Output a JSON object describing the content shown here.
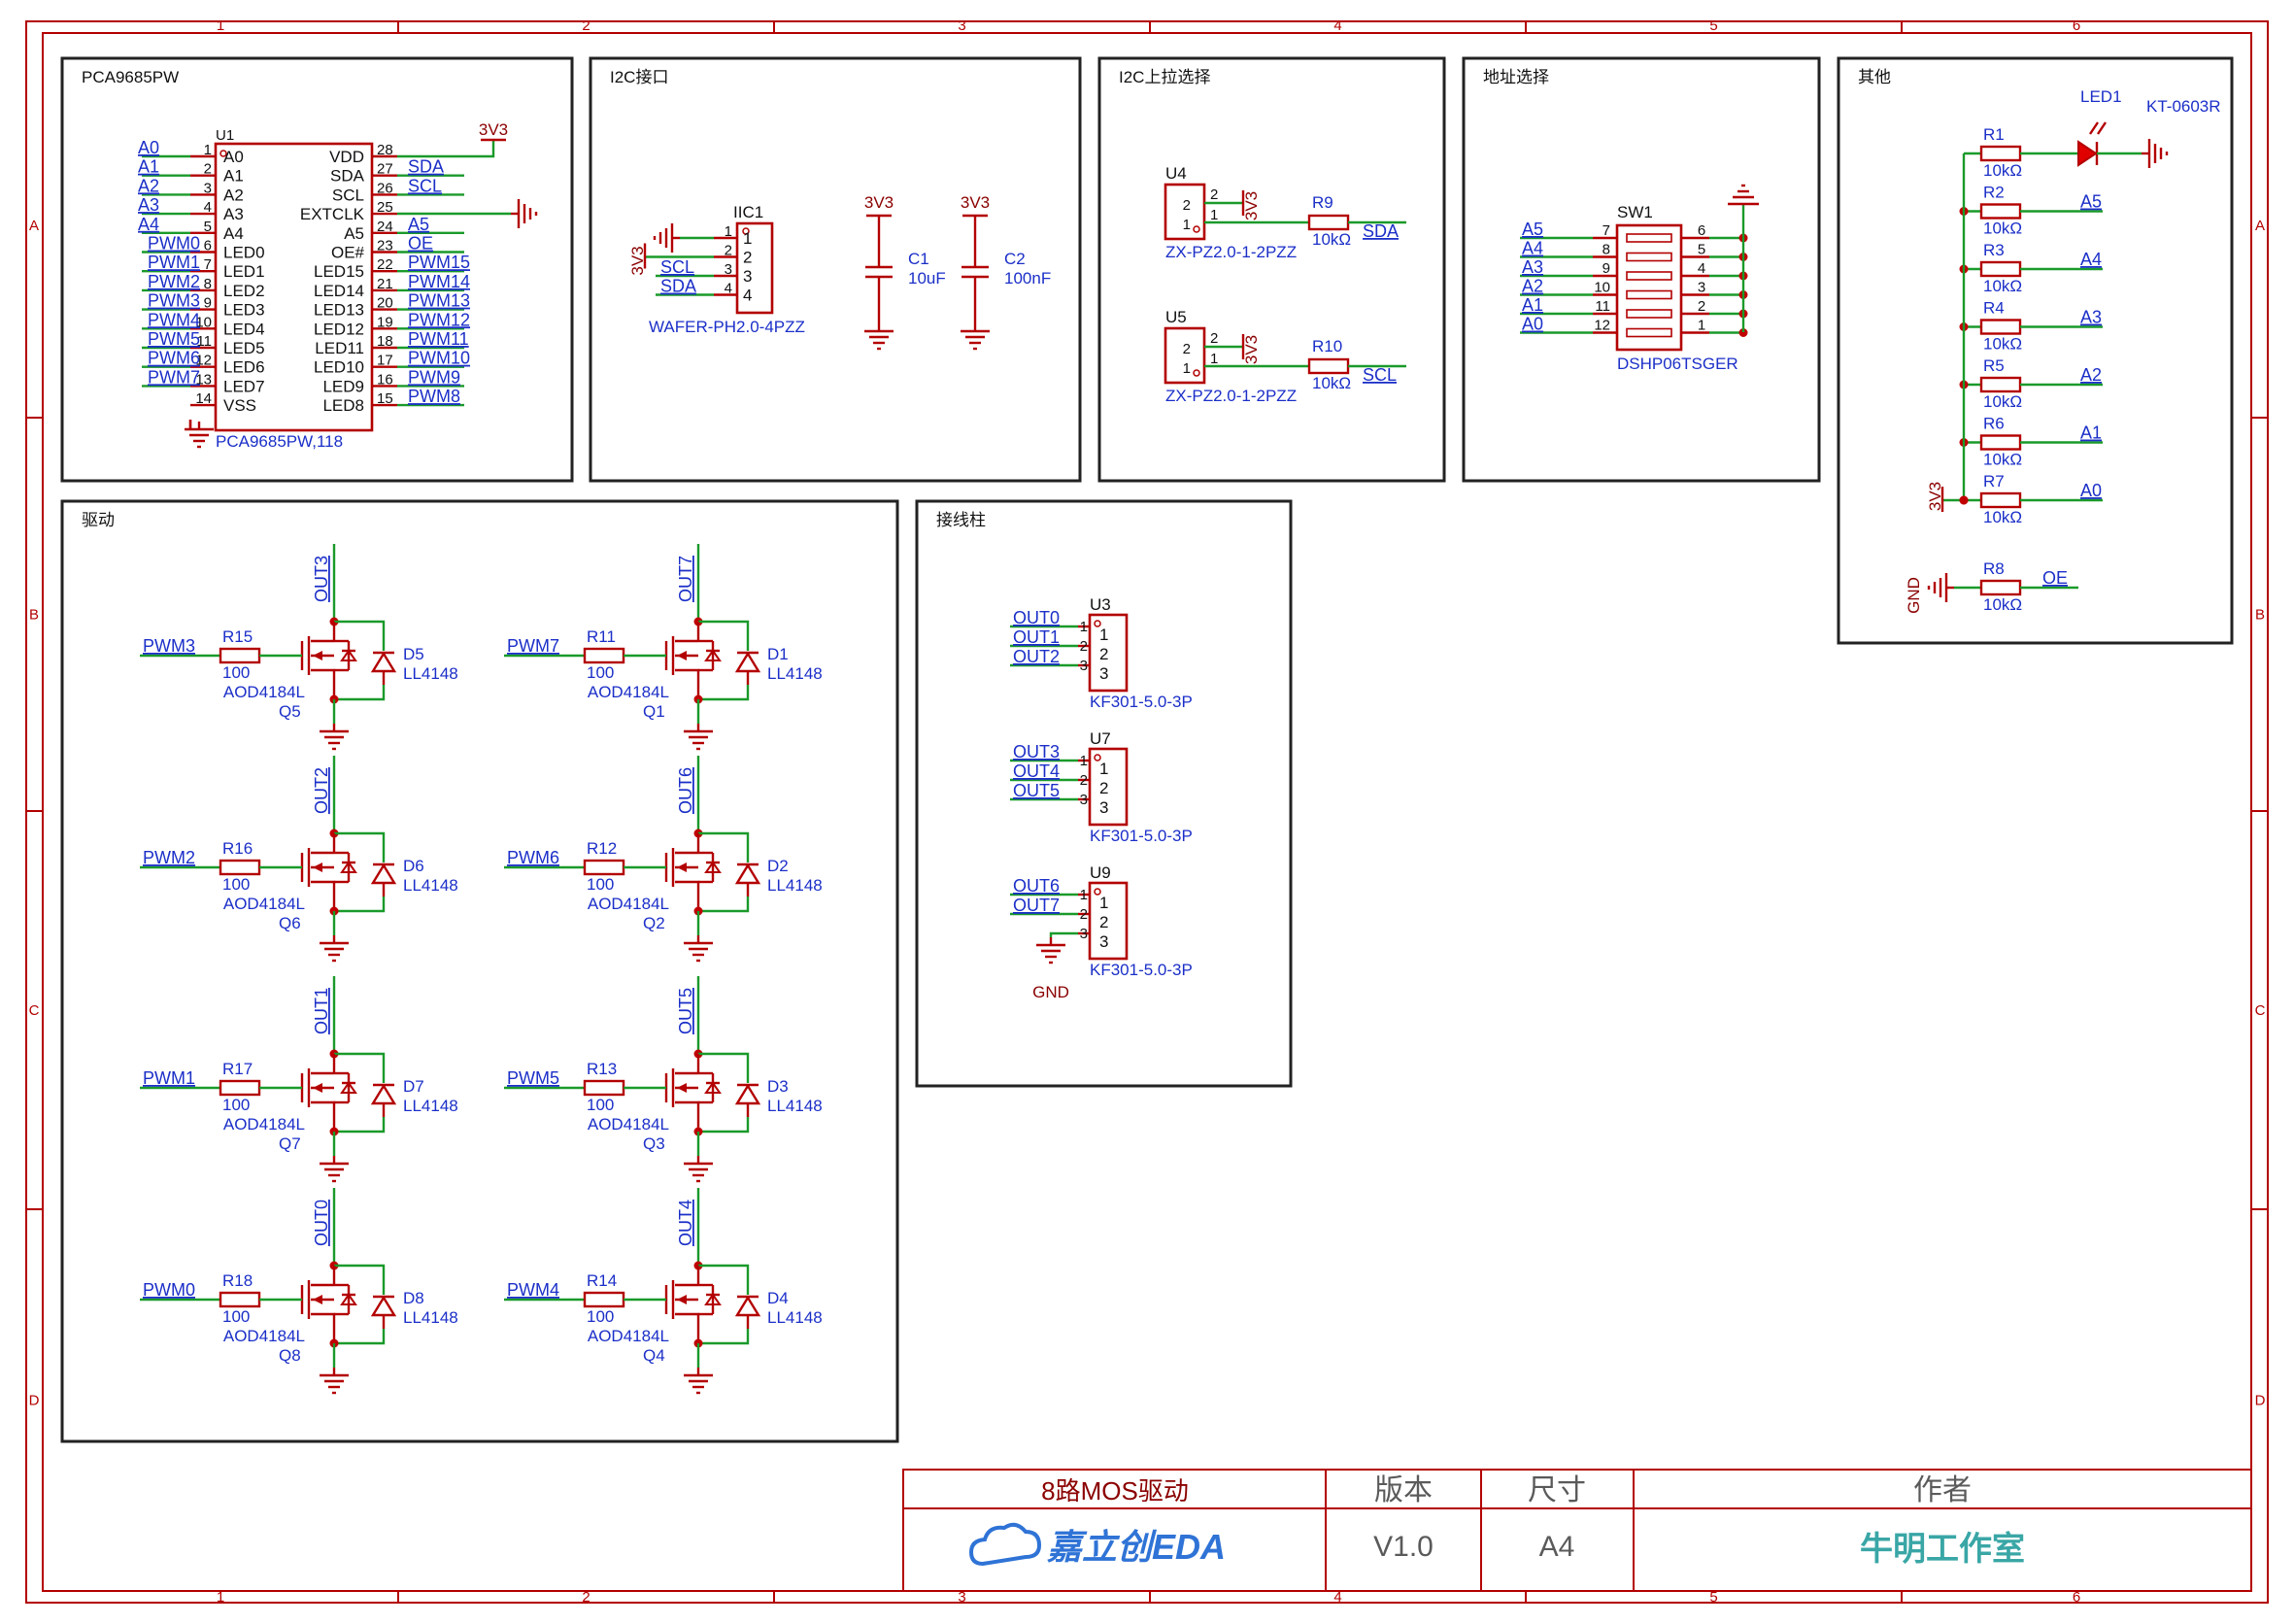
{
  "frame": {
    "columns": [
      "1",
      "2",
      "3",
      "4",
      "5",
      "6"
    ],
    "rows": [
      "A",
      "B",
      "C",
      "D"
    ]
  },
  "sections": {
    "pca": "PCA9685PW",
    "i2c": "I2C接口",
    "pullup": "I2C上拉选择",
    "addr": "地址选择",
    "other": "其他",
    "drive": "驱动",
    "terminal": "接线柱"
  },
  "u1": {
    "ref": "U1",
    "part": "PCA9685PW,118",
    "left_pins": [
      {
        "num": "1",
        "name": "A0",
        "net": "A0"
      },
      {
        "num": "2",
        "name": "A1",
        "net": "A1"
      },
      {
        "num": "3",
        "name": "A2",
        "net": "A2"
      },
      {
        "num": "4",
        "name": "A3",
        "net": "A3"
      },
      {
        "num": "5",
        "name": "A4",
        "net": "A4"
      },
      {
        "num": "6",
        "name": "LED0",
        "net": "PWM0"
      },
      {
        "num": "7",
        "name": "LED1",
        "net": "PWM1"
      },
      {
        "num": "8",
        "name": "LED2",
        "net": "PWM2"
      },
      {
        "num": "9",
        "name": "LED3",
        "net": "PWM3"
      },
      {
        "num": "10",
        "name": "LED4",
        "net": "PWM4"
      },
      {
        "num": "11",
        "name": "LED5",
        "net": "PWM5"
      },
      {
        "num": "12",
        "name": "LED6",
        "net": "PWM6"
      },
      {
        "num": "13",
        "name": "LED7",
        "net": "PWM7"
      },
      {
        "num": "14",
        "name": "VSS",
        "net": ""
      }
    ],
    "right_pins": [
      {
        "num": "28",
        "name": "VDD",
        "net": ""
      },
      {
        "num": "27",
        "name": "SDA",
        "net": "SDA"
      },
      {
        "num": "26",
        "name": "SCL",
        "net": "SCL"
      },
      {
        "num": "25",
        "name": "EXTCLK",
        "net": ""
      },
      {
        "num": "24",
        "name": "A5",
        "net": "A5"
      },
      {
        "num": "23",
        "name": "OE#",
        "net": "OE"
      },
      {
        "num": "22",
        "name": "LED15",
        "net": "PWM15"
      },
      {
        "num": "21",
        "name": "LED14",
        "net": "PWM14"
      },
      {
        "num": "20",
        "name": "LED13",
        "net": "PWM13"
      },
      {
        "num": "19",
        "name": "LED12",
        "net": "PWM12"
      },
      {
        "num": "18",
        "name": "LED11",
        "net": "PWM11"
      },
      {
        "num": "17",
        "name": "LED10",
        "net": "PWM10"
      },
      {
        "num": "16",
        "name": "LED9",
        "net": "PWM9"
      },
      {
        "num": "15",
        "name": "LED8",
        "net": "PWM8"
      }
    ],
    "power_label": "3V3"
  },
  "iic": {
    "ref": "IIC1",
    "part": "WAFER-PH2.0-4PZZ",
    "nets": [
      "",
      "3V3",
      "SCL",
      "SDA"
    ],
    "pins": [
      "1",
      "2",
      "3",
      "4"
    ],
    "caps": [
      {
        "ref": "C1",
        "value": "10uF",
        "power": "3V3"
      },
      {
        "ref": "C2",
        "value": "100nF",
        "power": "3V3"
      }
    ]
  },
  "pullups": [
    {
      "ref": "U4",
      "part": "ZX-PZ2.0-1-2PZZ",
      "power": "3V3",
      "res": "R9",
      "value": "10kΩ",
      "net": "SDA",
      "pins": [
        "2",
        "1"
      ]
    },
    {
      "ref": "U5",
      "part": "ZX-PZ2.0-1-2PZZ",
      "power": "3V3",
      "res": "R10",
      "value": "10kΩ",
      "net": "SCL",
      "pins": [
        "2",
        "1"
      ]
    }
  ],
  "sw1": {
    "ref": "SW1",
    "part": "DSHP06TSGER",
    "rows": [
      {
        "net": "A5",
        "left": "7",
        "right": "6"
      },
      {
        "net": "A4",
        "left": "8",
        "right": "5"
      },
      {
        "net": "A3",
        "left": "9",
        "right": "4"
      },
      {
        "net": "A2",
        "left": "10",
        "right": "3"
      },
      {
        "net": "A1",
        "left": "11",
        "right": "2"
      },
      {
        "net": "A0",
        "left": "12",
        "right": "1"
      }
    ]
  },
  "other": {
    "led": {
      "ref": "LED1",
      "part": "KT-0603R"
    },
    "resistors": [
      {
        "ref": "R1",
        "value": "10kΩ",
        "net": ""
      },
      {
        "ref": "R2",
        "value": "10kΩ",
        "net": "A5"
      },
      {
        "ref": "R3",
        "value": "10kΩ",
        "net": "A4"
      },
      {
        "ref": "R4",
        "value": "10kΩ",
        "net": "A3"
      },
      {
        "ref": "R5",
        "value": "10kΩ",
        "net": "A2"
      },
      {
        "ref": "R6",
        "value": "10kΩ",
        "net": "A1"
      },
      {
        "ref": "R7",
        "value": "10kΩ",
        "net": "A0"
      }
    ],
    "power_label": "3V3",
    "oe": {
      "ref": "R8",
      "value": "10kΩ",
      "net": "OE",
      "gnd": "GND"
    }
  },
  "drivers": [
    {
      "pwm": "PWM3",
      "res": "R15",
      "rval": "100",
      "mos": "AOD4184L",
      "q": "Q5",
      "out": "OUT3",
      "diode": "D5",
      "dpart": "LL4148"
    },
    {
      "pwm": "PWM7",
      "res": "R11",
      "rval": "100",
      "mos": "AOD4184L",
      "q": "Q1",
      "out": "OUT7",
      "diode": "D1",
      "dpart": "LL4148"
    },
    {
      "pwm": "PWM2",
      "res": "R16",
      "rval": "100",
      "mos": "AOD4184L",
      "q": "Q6",
      "out": "OUT2",
      "diode": "D6",
      "dpart": "LL4148"
    },
    {
      "pwm": "PWM6",
      "res": "R12",
      "rval": "100",
      "mos": "AOD4184L",
      "q": "Q2",
      "out": "OUT6",
      "diode": "D2",
      "dpart": "LL4148"
    },
    {
      "pwm": "PWM1",
      "res": "R17",
      "rval": "100",
      "mos": "AOD4184L",
      "q": "Q7",
      "out": "OUT1",
      "diode": "D7",
      "dpart": "LL4148"
    },
    {
      "pwm": "PWM5",
      "res": "R13",
      "rval": "100",
      "mos": "AOD4184L",
      "q": "Q3",
      "out": "OUT5",
      "diode": "D3",
      "dpart": "LL4148"
    },
    {
      "pwm": "PWM0",
      "res": "R18",
      "rval": "100",
      "mos": "AOD4184L",
      "q": "Q8",
      "out": "OUT0",
      "diode": "D8",
      "dpart": "LL4148"
    },
    {
      "pwm": "PWM4",
      "res": "R14",
      "rval": "100",
      "mos": "AOD4184L",
      "q": "Q4",
      "out": "OUT4",
      "diode": "D4",
      "dpart": "LL4148"
    }
  ],
  "terminals": [
    {
      "ref": "U3",
      "part": "KF301-5.0-3P",
      "nets": [
        "OUT0",
        "OUT1",
        "OUT2"
      ]
    },
    {
      "ref": "U7",
      "part": "KF301-5.0-3P",
      "nets": [
        "OUT3",
        "OUT4",
        "OUT5"
      ]
    },
    {
      "ref": "U9",
      "part": "KF301-5.0-3P",
      "nets": [
        "OUT6",
        "OUT7",
        ""
      ],
      "gnd": "GND"
    }
  ],
  "titleblock": {
    "title": "8路MOS驱动",
    "version_label": "版本",
    "size_label": "尺寸",
    "author_label": "作者",
    "logo": "嘉立创EDA",
    "version": "V1.0",
    "size": "A4",
    "author": "牛明工作室"
  },
  "colors": {
    "frame": "#b30000",
    "wire": "#1a9a2a",
    "net_label": "#1b2fc8",
    "component": "#b30000",
    "junction": "#c00000",
    "author": "#3aa6a6",
    "logo": "#2f73d6"
  }
}
